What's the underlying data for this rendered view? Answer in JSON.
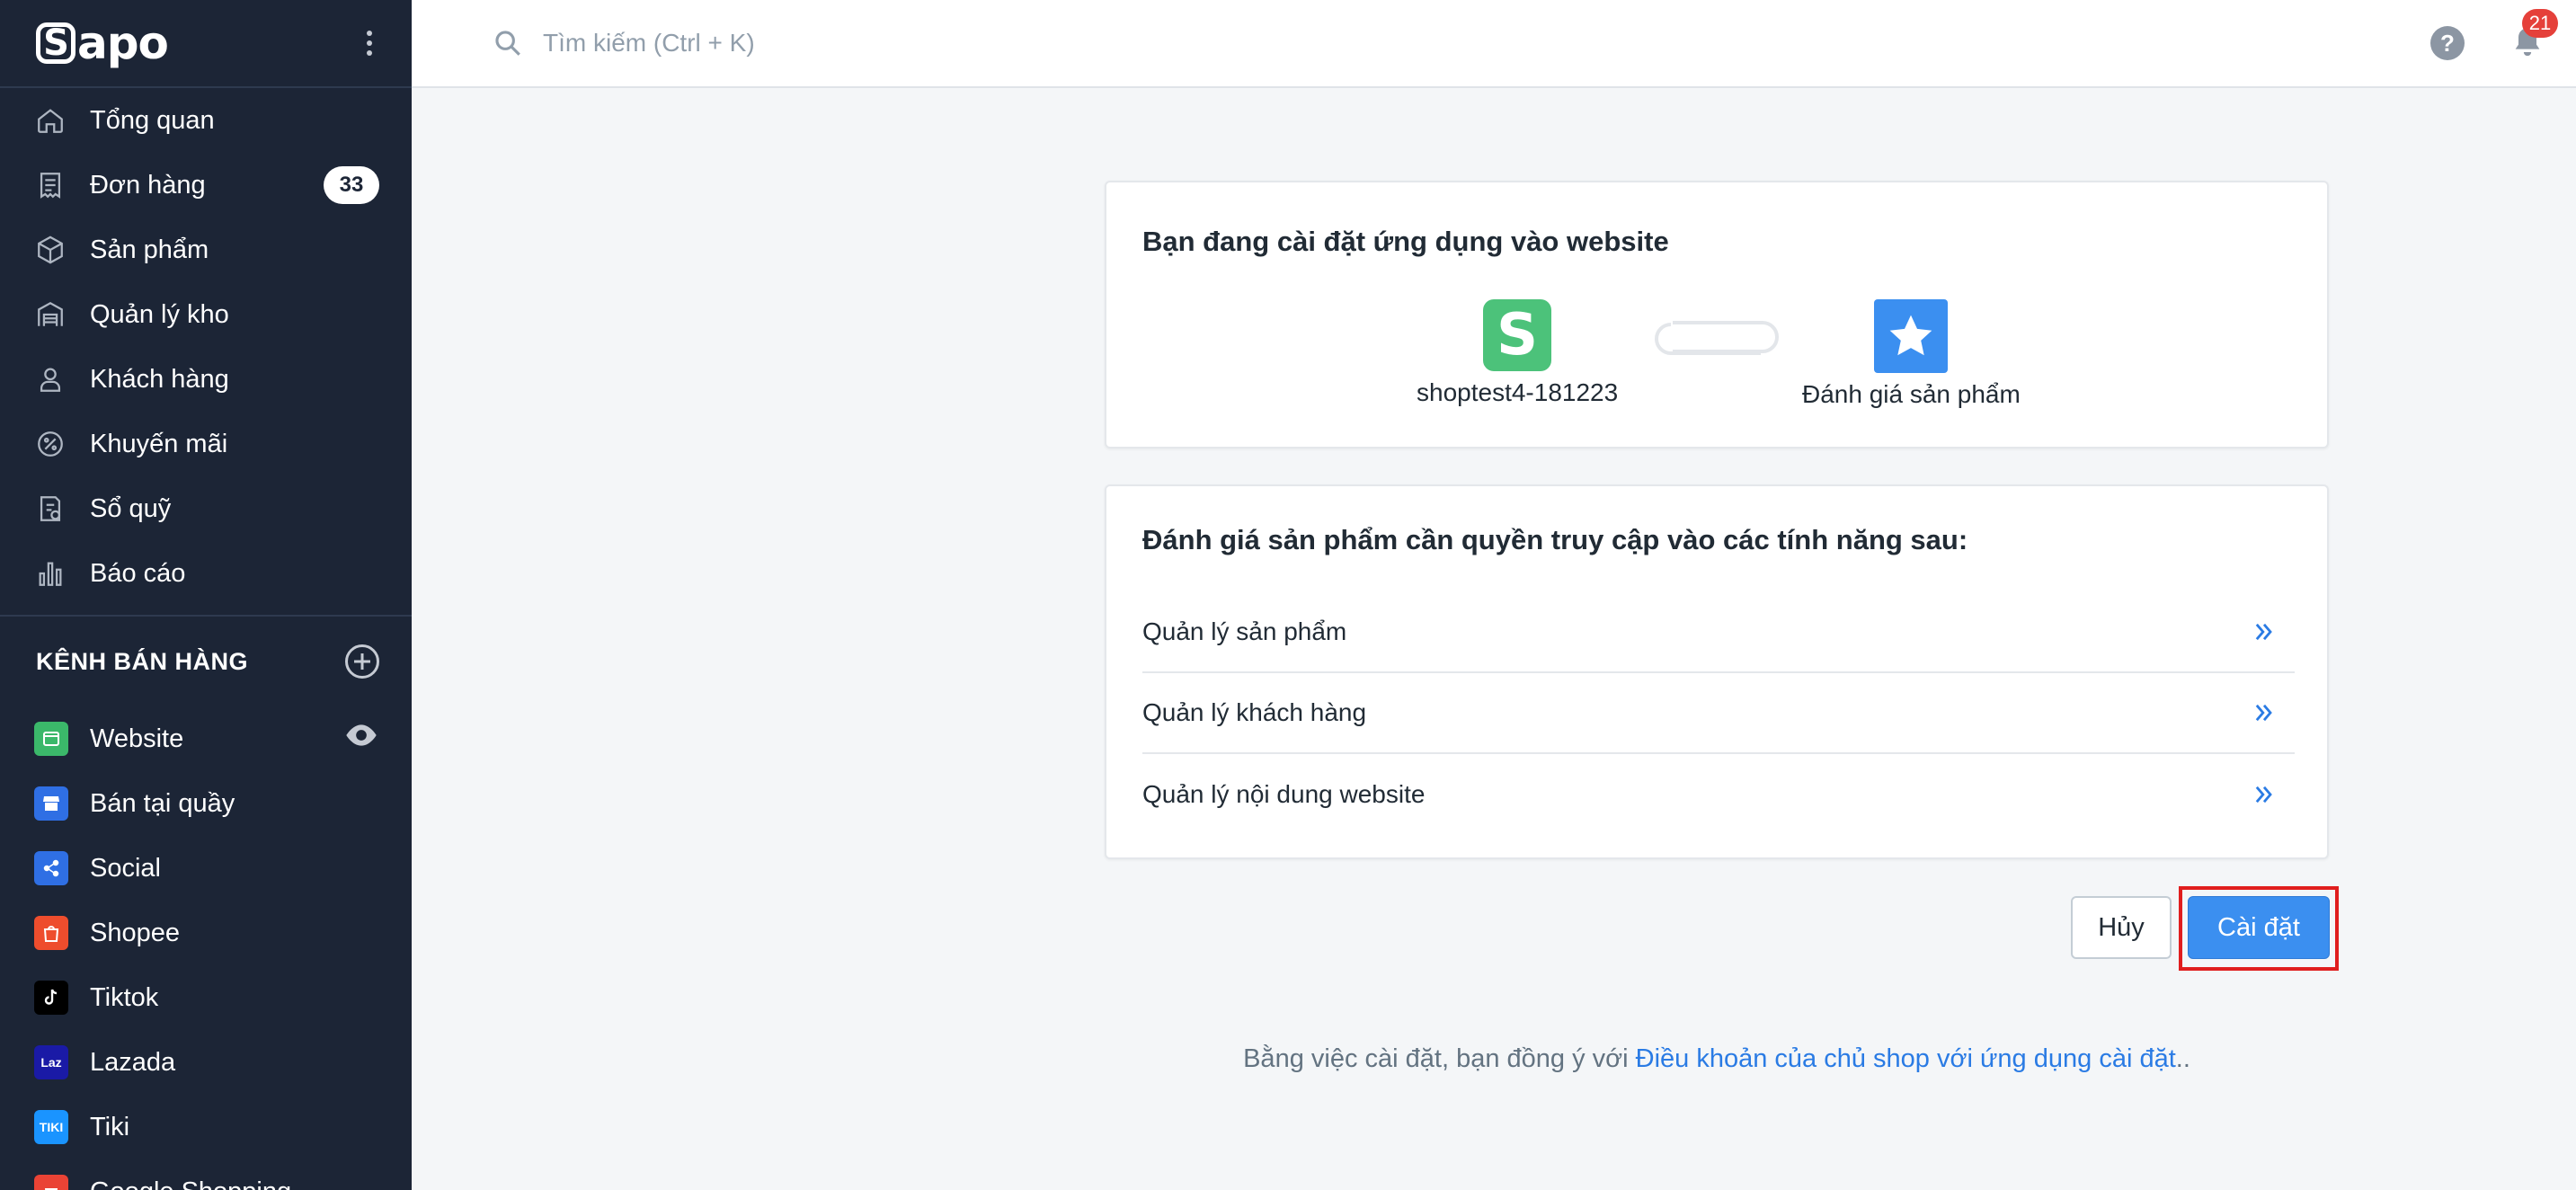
{
  "brand": {
    "logo_text": "apo",
    "logo_s": "S"
  },
  "sidebar": {
    "items": [
      {
        "label": "Tổng quan",
        "icon": "home-icon"
      },
      {
        "label": "Đơn hàng",
        "icon": "receipt-icon",
        "badge": "33"
      },
      {
        "label": "Sản phẩm",
        "icon": "box-icon"
      },
      {
        "label": "Quản lý kho",
        "icon": "warehouse-icon"
      },
      {
        "label": "Khách hàng",
        "icon": "user-icon"
      },
      {
        "label": "Khuyến mãi",
        "icon": "discount-icon"
      },
      {
        "label": "Sổ quỹ",
        "icon": "cashbook-icon"
      },
      {
        "label": "Báo cáo",
        "icon": "bar-chart-icon"
      }
    ],
    "channels_heading": "KÊNH BÁN HÀNG",
    "channels": [
      {
        "label": "Website",
        "icon": "website-icon",
        "color": "#3bb86a"
      },
      {
        "label": "Bán tại quầy",
        "icon": "store-icon",
        "color": "#2f6fe4"
      },
      {
        "label": "Social",
        "icon": "share-icon",
        "color": "#2f6fe4"
      },
      {
        "label": "Shopee",
        "icon": "shopee-icon",
        "color": "#ee4d2d"
      },
      {
        "label": "Tiktok",
        "icon": "tiktok-icon",
        "color": "#000000"
      },
      {
        "label": "Lazada",
        "icon": "lazada-icon",
        "color": "#1a1aa6",
        "icon_text": "Laz"
      },
      {
        "label": "Tiki",
        "icon": "tiki-icon",
        "color": "#1a94ff",
        "icon_text": "TIKI"
      },
      {
        "label": "Google Shopping",
        "icon": "google-shopping-icon",
        "color": "#ea4335"
      }
    ]
  },
  "topbar": {
    "search_placeholder": "Tìm kiếm (Ctrl + K)",
    "help_label": "?",
    "notification_count": "21"
  },
  "install": {
    "title": "Bạn đang cài đặt ứng dụng vào website",
    "shop_name": "shoptest4-181223",
    "app_name": "Đánh giá sản phẩm"
  },
  "permissions": {
    "title": "Đánh giá sản phẩm cần quyền truy cập vào các tính năng sau:",
    "items": [
      "Quản lý sản phẩm",
      "Quản lý khách hàng",
      "Quản lý nội dung website"
    ]
  },
  "actions": {
    "cancel_label": "Hủy",
    "install_label": "Cài đặt"
  },
  "agreement": {
    "prefix": "Bằng việc cài đặt, bạn đồng ý với ",
    "link_text": "Điều khoản của chủ shop với ứng dụng cài đặt",
    "suffix": ".."
  },
  "colors": {
    "sidebar_bg": "#1c2536",
    "primary": "#3b8ff0",
    "highlight": "#e01e1e"
  }
}
